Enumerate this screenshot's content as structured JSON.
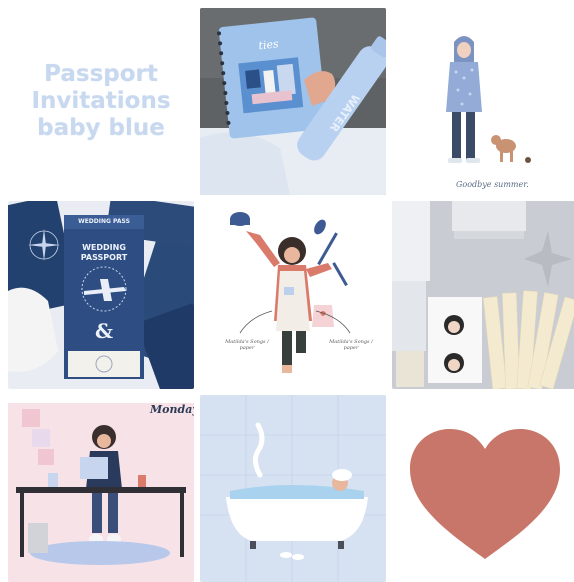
{
  "title_tile": {
    "lines": [
      "Passport",
      "Invitations",
      "baby blue"
    ]
  },
  "illustration_summer": {
    "caption": "Goodbye summer."
  },
  "wedding_pass": {
    "header": "WEDDING PASS",
    "title_line1": "WEDDING",
    "title_line2": "PASSPORT",
    "amp": "&"
  },
  "chef_illustration": {
    "left_note": "Matilda's Songs / paper",
    "right_note": "Matilda's Songs / paper"
  },
  "monday_tile": {
    "heading": "Monday"
  },
  "colors": {
    "baby_blue": "#c7d8ef",
    "navy": "#2c4a7a",
    "heart": "#c9766a",
    "pink": "#f3d9df"
  }
}
